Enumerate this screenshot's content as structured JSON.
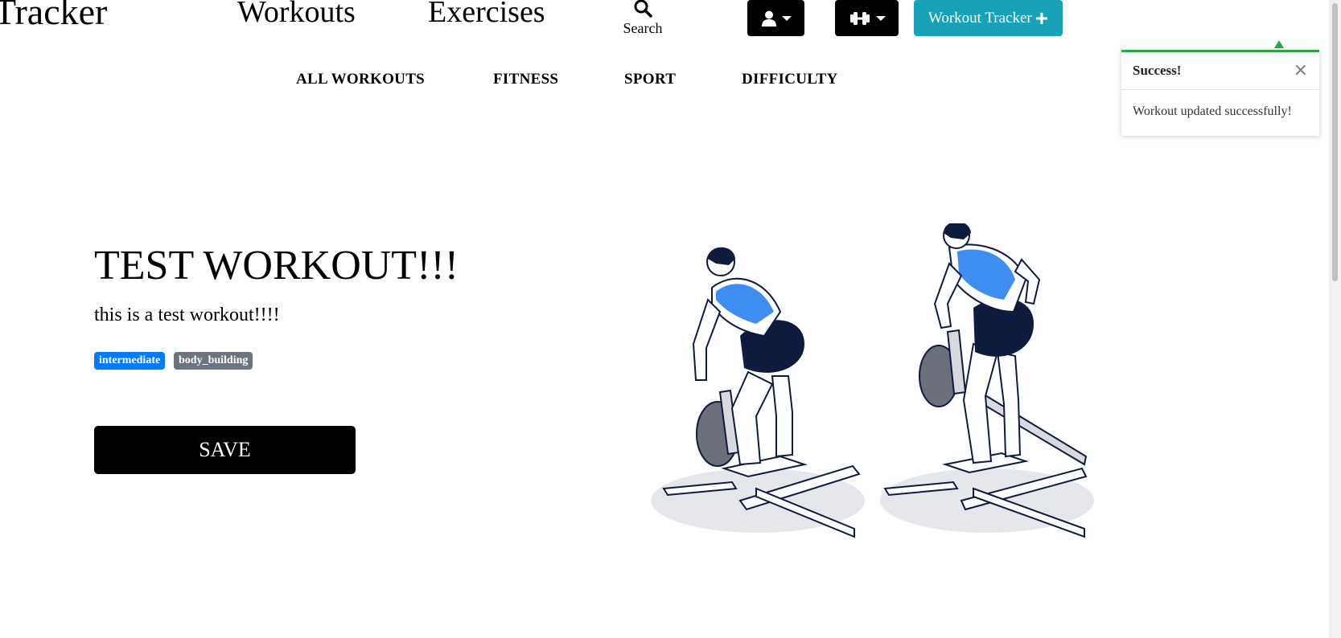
{
  "header": {
    "brand": "Tracker",
    "nav": [
      "Workouts",
      "Exercises"
    ],
    "search_label": "Search",
    "cta_label": "Workout Tracker"
  },
  "subnav": [
    "ALL WORKOUTS",
    "FITNESS",
    "SPORT",
    "DIFFICULTY"
  ],
  "toast": {
    "title": "Success!",
    "close": "×",
    "message": "Workout updated successfully!"
  },
  "workout": {
    "title": "TEST WORKOUT!!!",
    "description": "this is a test workout!!!!",
    "tags": [
      {
        "label": "intermediate",
        "color": "#007bff"
      },
      {
        "label": "body_building",
        "color": "#6c757d"
      }
    ],
    "save_label": "SAVE"
  },
  "icons": {
    "search": "search-icon",
    "user": "user-icon",
    "dumbbell": "dumbbell-icon",
    "plus": "plus-icon",
    "close": "close-icon"
  },
  "colors": {
    "accent": "#17a2b8",
    "success": "#28a745",
    "primary_badge": "#007bff",
    "secondary_badge": "#6c757d",
    "muscle_highlight": "#3d8ef0",
    "navy": "#0f1a3f"
  }
}
